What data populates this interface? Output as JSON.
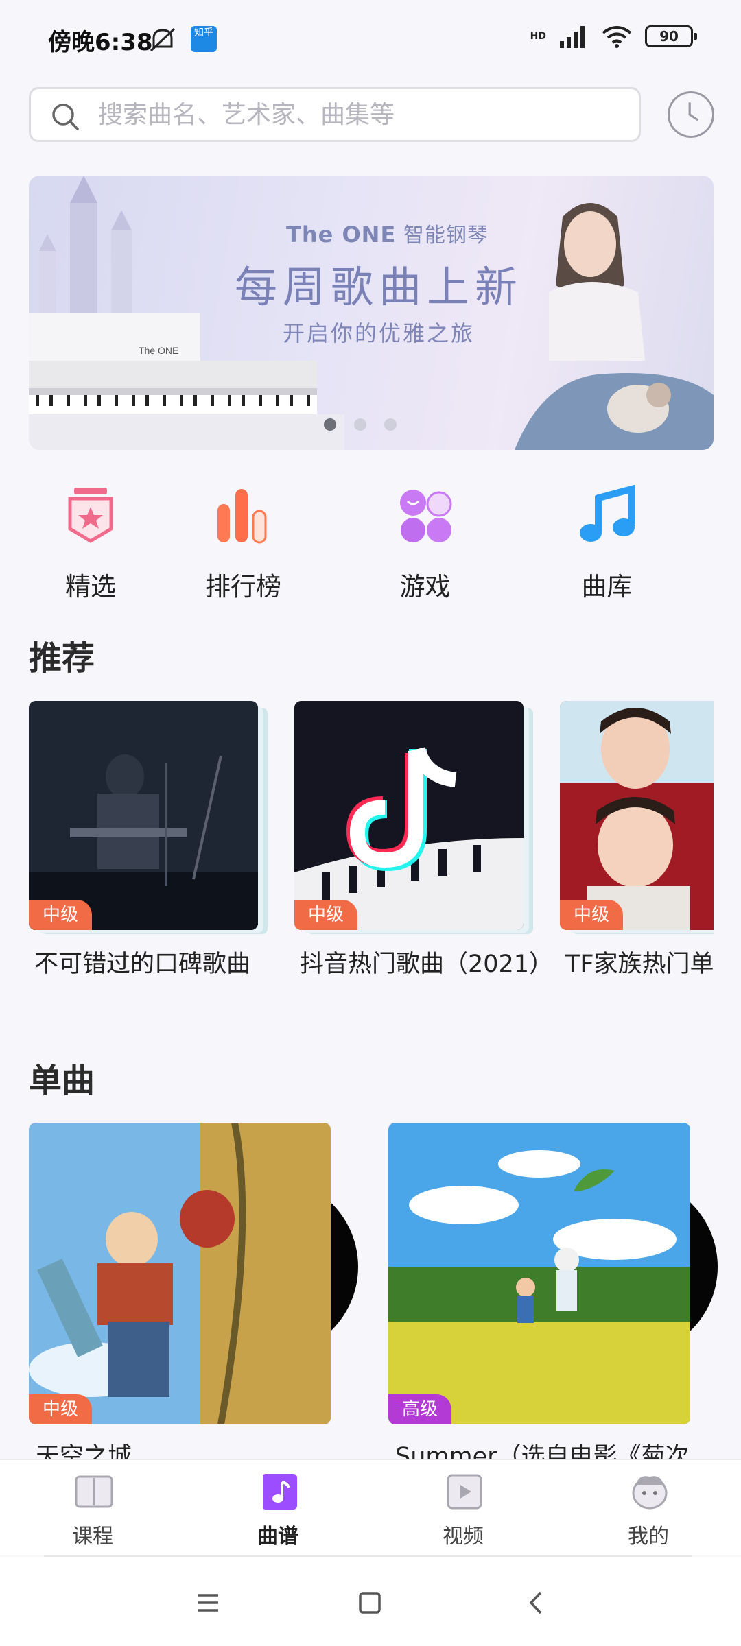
{
  "status_bar": {
    "time": "傍晚6:38",
    "app_badge": "知乎",
    "network": "HD",
    "battery": "90"
  },
  "search": {
    "placeholder": "搜索曲名、艺术家、曲集等"
  },
  "banner": {
    "brand": "The ONE",
    "brand_suffix": "智能钢琴",
    "title": "每周歌曲上新",
    "subtitle": "开启你的优雅之旅",
    "piano_logo": "The ONE",
    "dots": 3,
    "active_dot": 0
  },
  "categories": [
    {
      "label": "精选",
      "icon": "badge-star-icon",
      "color": "#f06a8c"
    },
    {
      "label": "排行榜",
      "icon": "bar-chart-icon",
      "color": "#ff6e4a"
    },
    {
      "label": "游戏",
      "icon": "game-bubbles-icon",
      "color": "#c06ef0"
    },
    {
      "label": "曲库",
      "icon": "music-note-icon",
      "color": "#2a9df4"
    }
  ],
  "recommend": {
    "title": "推荐",
    "items": [
      {
        "level": "中级",
        "title": "不可错过的口碑歌曲"
      },
      {
        "level": "中级",
        "title": "抖音热门歌曲（2021）"
      },
      {
        "level": "中级",
        "title": "TF家族热门单"
      }
    ]
  },
  "singles": {
    "title": "单曲",
    "items": [
      {
        "level": "中级",
        "title": "天空之城"
      },
      {
        "level": "高级",
        "title": "Summer（选自电影《菊次"
      }
    ]
  },
  "bottom_nav": [
    {
      "label": "课程",
      "icon": "book-icon"
    },
    {
      "label": "曲谱",
      "icon": "sheet-music-icon",
      "active": true
    },
    {
      "label": "视频",
      "icon": "play-icon"
    },
    {
      "label": "我的",
      "icon": "profile-face-icon"
    }
  ],
  "colors": {
    "accent": "#9b4dff",
    "level_mid": "#f26b47",
    "level_high": "#b43ad6"
  }
}
